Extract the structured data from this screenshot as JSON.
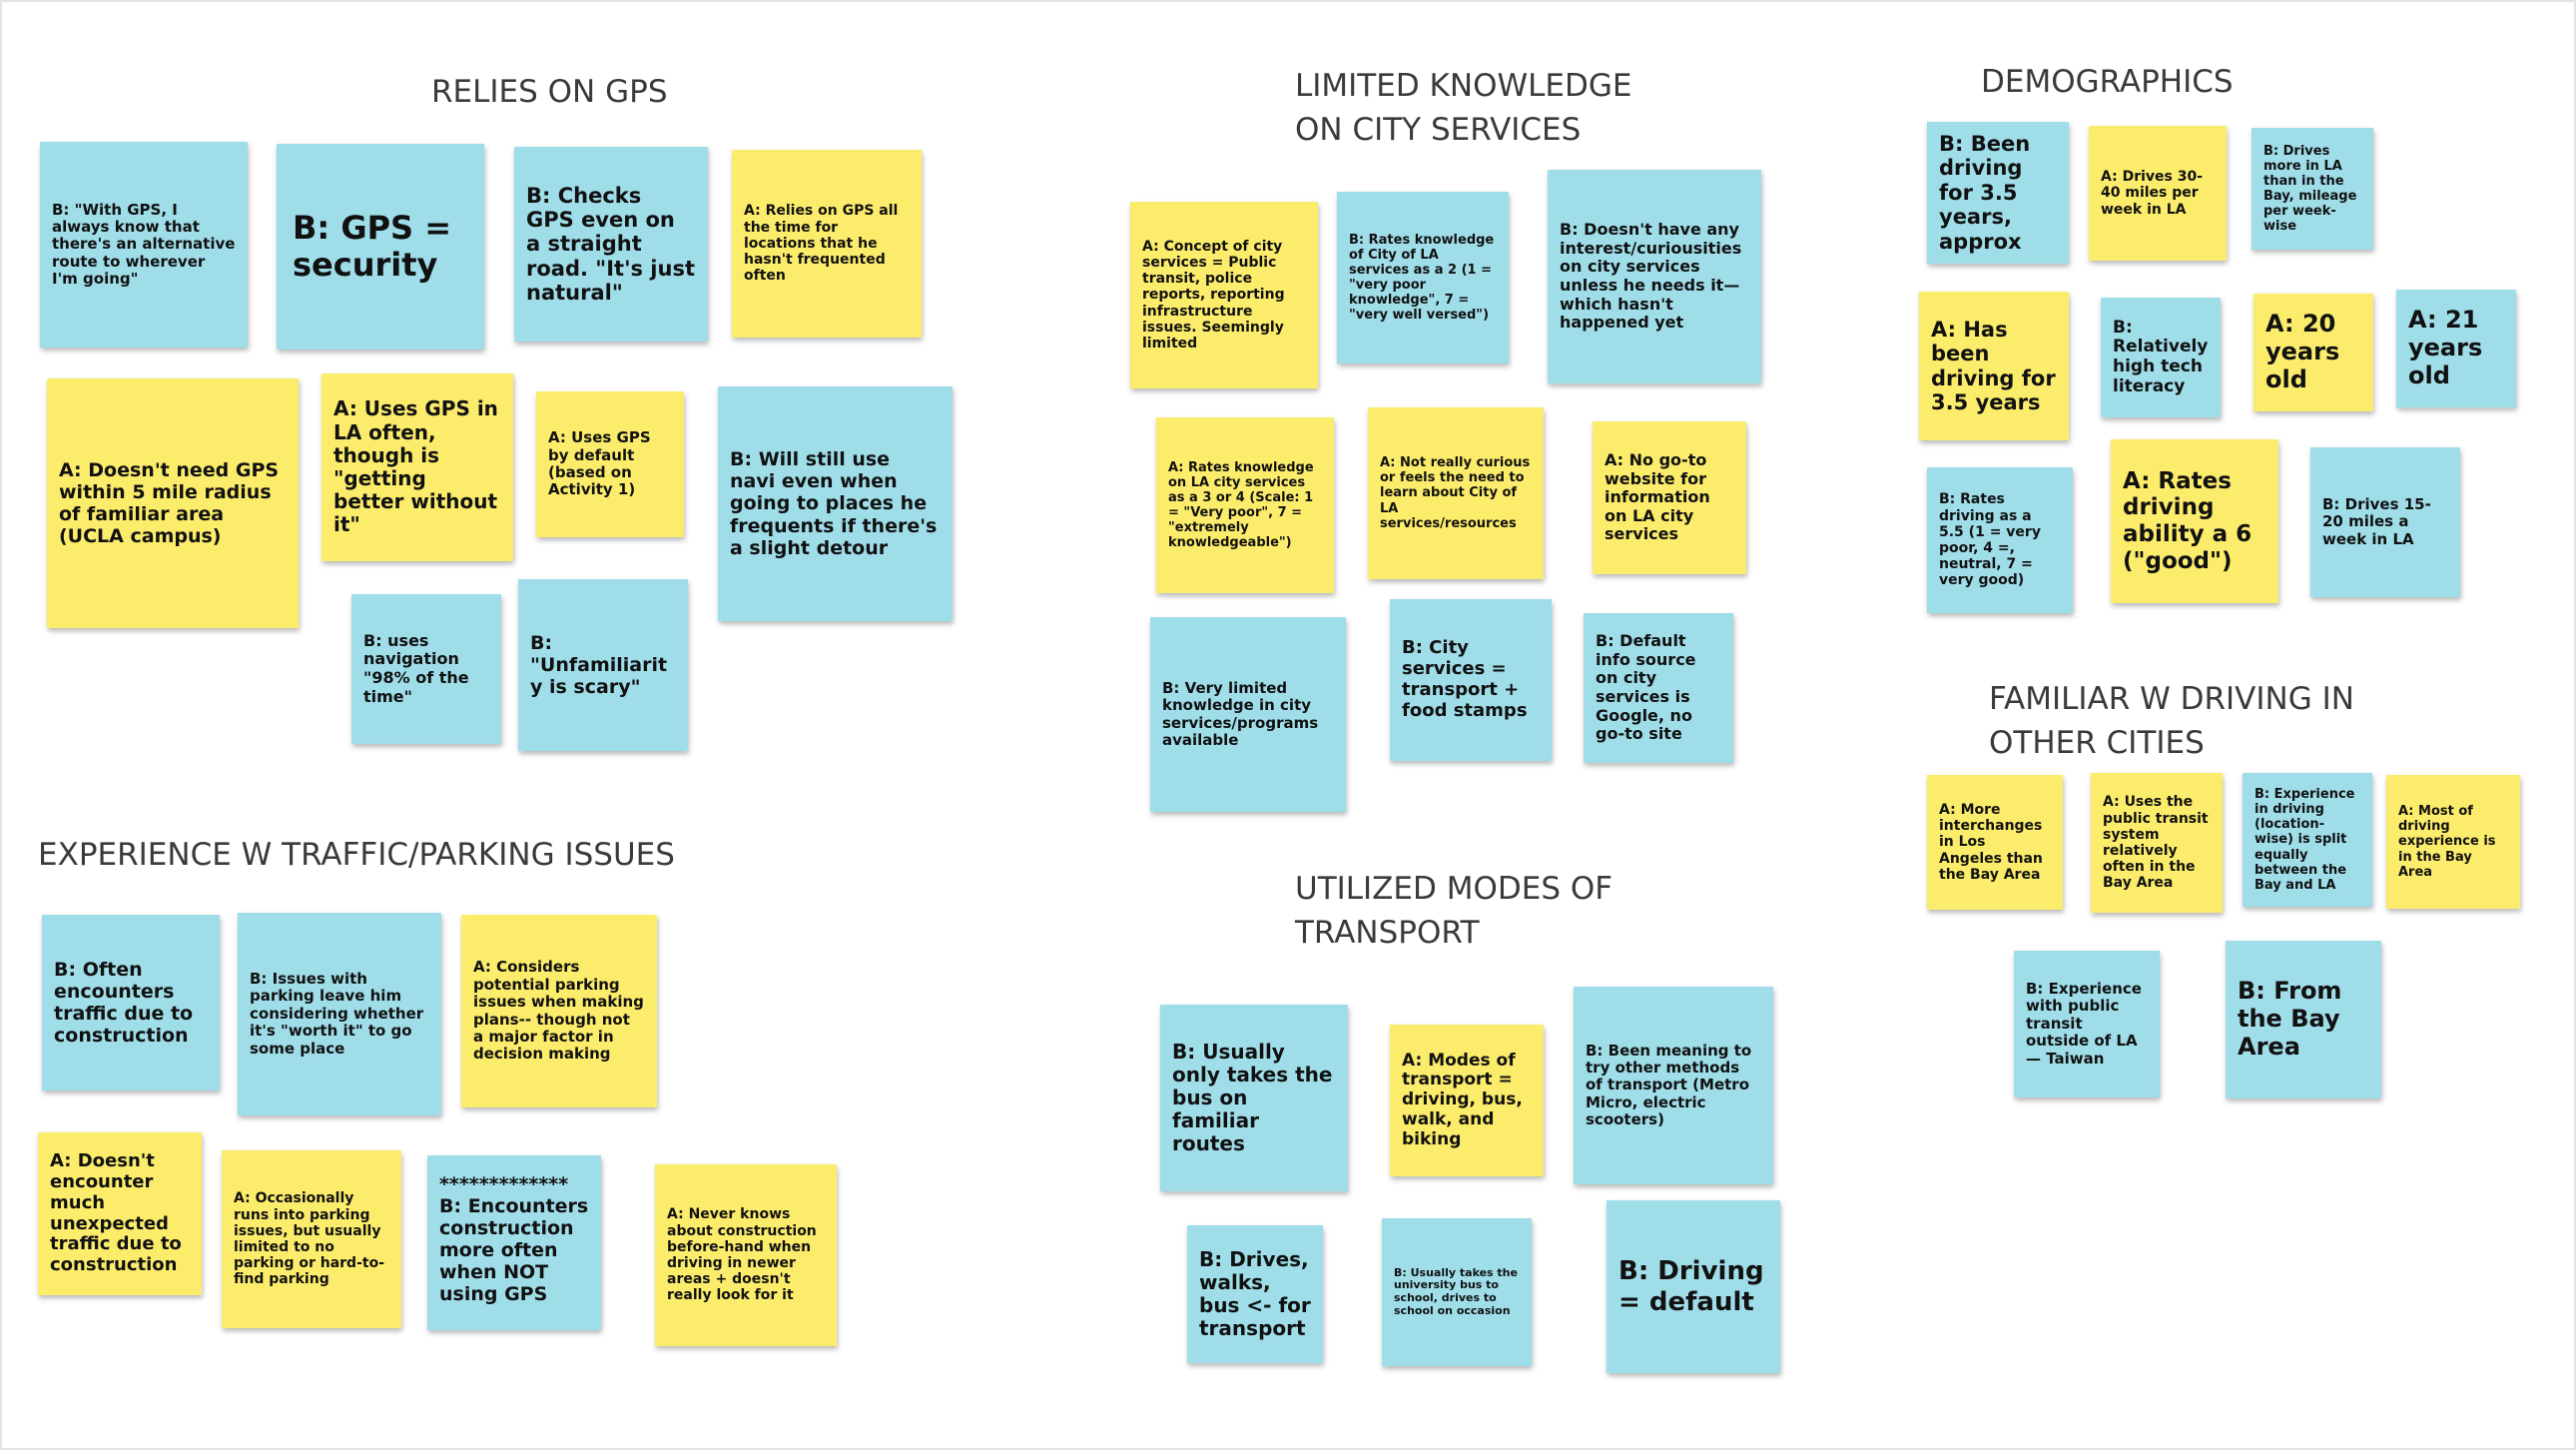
{
  "colors": {
    "blue_note": "#9fdde9",
    "yellow_note": "#fcec6b",
    "heading": "#3a3a3a"
  },
  "clusters": {
    "relies_on_gps": {
      "title": "RELIES ON GPS",
      "notes": [
        "B: \"With GPS, I always know that there's an alternative route to wherever I'm going\"",
        "B: GPS = security",
        "B: Checks GPS even on a straight road. \"It's just natural\"",
        "A: Relies on GPS all the time for locations that he hasn't frequented often",
        "A: Doesn't need GPS within 5 mile radius of familiar area (UCLA campus)",
        "A: Uses GPS in LA often, though is \"getting better without it\"",
        "A: Uses GPS by default (based on Activity 1)",
        "B: Will still use navi even when going to places he frequents if there's a slight detour",
        "B: uses navigation \"98% of the time\"",
        "B: \"Unfamiliarity is scary\""
      ]
    },
    "limited_knowledge": {
      "title": "LIMITED KNOWLEDGE\nON CITY SERVICES",
      "notes": [
        "A: Concept of city services = Public transit, police reports, reporting infrastructure issues. Seemingly limited",
        "B: Rates knowledge of City of LA services as a 2 (1 = \"very poor knowledge\", 7 = \"very well versed\")",
        "B: Doesn't have any interest/curiousities on city services unless he needs it— which hasn't happened yet",
        "A: Rates knowledge on LA city services as a 3 or 4 (Scale: 1 = \"Very poor\", 7 = \"extremely knowledgeable\")",
        "A: Not really curious or feels the need to learn about City of LA services/resources",
        "A: No go-to website for information on LA city services",
        "B: Very limited knowledge in city services/programs available",
        "B: City services = transport + food stamps",
        "B: Default info source on city services is Google, no go-to site"
      ]
    },
    "demographics": {
      "title": "DEMOGRAPHICS",
      "notes": [
        "B: Been driving for 3.5 years, approx",
        "A: Drives 30-40 miles per week in LA",
        "B: Drives more in LA than in the Bay, mileage per week-wise",
        "A: Has been driving for 3.5 years",
        "B: Relatively high tech literacy",
        "A: 20 years old",
        "A: 21 years old",
        "B: Rates driving as a 5.5 (1 = very poor, 4 =, neutral, 7 = very good)",
        "A: Rates driving ability a 6 (\"good\")",
        "B: Drives 15-20 miles a week in LA"
      ]
    },
    "familiar_other_cities": {
      "title": "FAMILIAR W DRIVING IN\nOTHER CITIES",
      "notes": [
        "A: More interchanges in Los Angeles than the Bay Area",
        "A: Uses the public transit system relatively often in the Bay Area",
        "B: Experience in driving (location-wise) is split equally between the Bay and LA",
        "A: Most of driving experience is in the Bay Area",
        "B: Experience with public transit outside of LA— Taiwan",
        "B: From the Bay Area"
      ]
    },
    "traffic_parking": {
      "title": "EXPERIENCE W TRAFFIC/PARKING ISSUES",
      "notes": [
        "B: Often encounters traffic due to construction",
        "B: Issues with parking leave him considering whether it's \"worth it\" to go some place",
        "A: Considers potential parking issues when making plans-- though not a major factor in decision making",
        "A: Doesn't encounter much unexpected traffic due to construction",
        "A: Occasionally runs into parking issues, but usually limited to no parking or hard-to-find parking",
        "************* B: Encounters construction more often when NOT using GPS",
        "A: Never knows about construction before-hand when driving in newer areas + doesn't really look for it"
      ]
    },
    "modes_of_transport": {
      "title": "UTILIZED MODES OF\nTRANSPORT",
      "notes": [
        "B: Usually only takes the bus on familiar routes",
        "A: Modes of transport = driving, bus, walk, and biking",
        "B: Been meaning to try other methods of transport (Metro Micro, electric scooters)",
        "B: Drives, walks, bus <- for transport",
        "B: Usually takes the university bus to school, drives to school on occasion",
        "B: Driving = default"
      ]
    }
  }
}
